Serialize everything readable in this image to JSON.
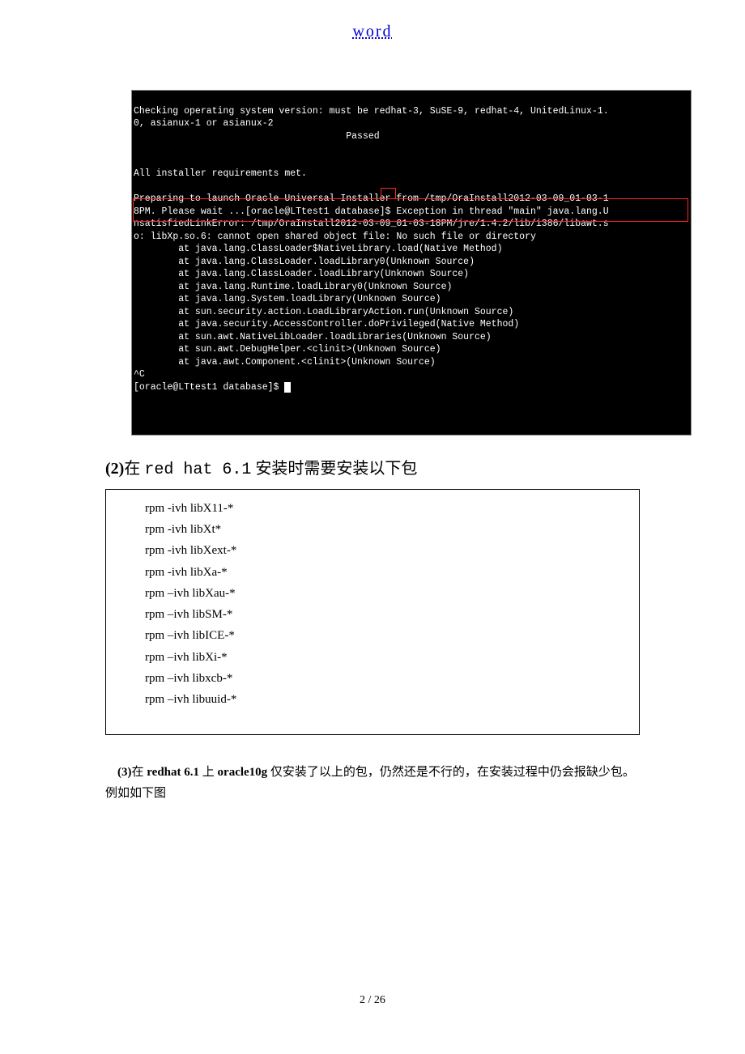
{
  "header": {
    "title": "word"
  },
  "terminal": {
    "line1": "Checking operating system version: must be redhat-3, SuSE-9, redhat-4, UnitedLinux-1.",
    "line2": "0, asianux-1 or asianux-2",
    "line3": "                                      Passed",
    "line4": "",
    "line5": "",
    "line6": "All installer requirements met.",
    "line7": "",
    "line8": "Preparing to launch Oracle Universal Installer from /tmp/OraInstall2012-03-09_01-03-1",
    "line9a": "8PM. Please wait ...[oracle@LTtest1 database]",
    "line9b": "$",
    "line9c": " Exception in thread \"main\" java.lang.U",
    "line10a": "n",
    "line10b": "satisfiedLinkError: /tmp/OraInstall2012-03-09_01-03-18PM/jre/1.4.2/lib/i386/libawt.",
    "line10c": "s",
    "line11a": "o",
    "line11b": ": libXp.so.6: cannot open shared object file: No such file or directory",
    "trace1": "        at java.lang.ClassLoader$NativeLibrary.load(Native Method)",
    "trace2": "        at java.lang.ClassLoader.loadLibrary0(Unknown Source)",
    "trace3": "        at java.lang.ClassLoader.loadLibrary(Unknown Source)",
    "trace4": "        at java.lang.Runtime.loadLibrary0(Unknown Source)",
    "trace5": "        at java.lang.System.loadLibrary(Unknown Source)",
    "trace6": "        at sun.security.action.LoadLibraryAction.run(Unknown Source)",
    "trace7": "        at java.security.AccessController.doPrivileged(Native Method)",
    "trace8": "        at sun.awt.NativeLibLoader.loadLibraries(Unknown Source)",
    "trace9": "        at sun.awt.DebugHelper.<clinit>(Unknown Source)",
    "trace10": "        at java.awt.Component.<clinit>(Unknown Source)",
    "ctrlc": "^C",
    "prompt": "[oracle@LTtest1 database]$ "
  },
  "section2": {
    "prefix_num": "(2)",
    "prefix_text": "在 ",
    "redhat": "red hat 6.1",
    "suffix": " 安装时需要安装以下包"
  },
  "rpm": {
    "items": [
      "rpm -ivh libX11-*",
      "rpm -ivh libXt*",
      "rpm -ivh libXext-*",
      "rpm -ivh libXa-*",
      "rpm –ivh libXau-*",
      "rpm –ivh libSM-*",
      "rpm –ivh libICE-*",
      "rpm –ivh libXi-*",
      "rpm –ivh libxcb-*",
      "rpm –ivh libuuid-*"
    ]
  },
  "section3": {
    "indent": "　",
    "num": "(3)",
    "part1": "在 ",
    "bold1": "redhat 6.1",
    "part2": " 上 ",
    "bold2": "oracle10g",
    "part3": " 仅安装了以上的包，仍然还是不行的，在安装过程中仍会报缺少包。例如如下图"
  },
  "footer": {
    "page": "2 / 26"
  }
}
